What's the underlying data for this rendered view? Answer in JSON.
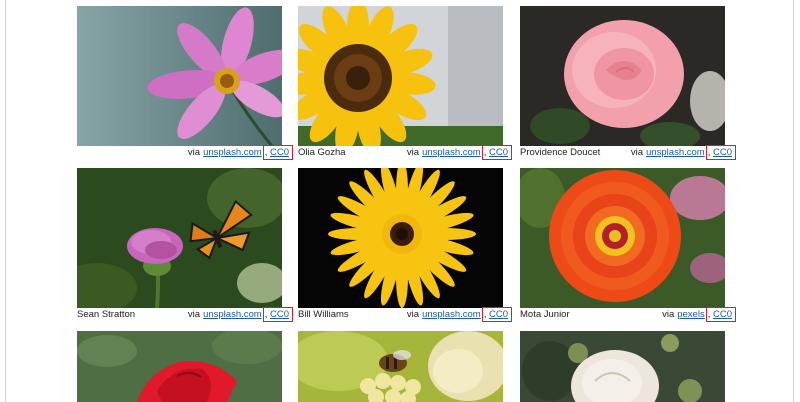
{
  "gallery": {
    "cards": [
      {
        "photographer": "",
        "via": "via",
        "source": "unsplash.com",
        "sep": ",",
        "license": "CC0",
        "subject": "pink cosmos flower",
        "colors": {
          "bg": "#6f9193",
          "petal": "#d779c9",
          "center": "#e0b020"
        }
      },
      {
        "photographer": "Olia Gozha",
        "via": "via",
        "source": "unsplash.com",
        "sep": ",",
        "license": "CC0",
        "subject": "yellow sunflower",
        "colors": {
          "bg": "#c9ccd0",
          "petal": "#f5c510",
          "center": "#4a2a10"
        }
      },
      {
        "photographer": "Providence Doucet",
        "via": "via",
        "source": "unsplash.com",
        "sep": ",",
        "license": "CC0",
        "subject": "pink rose",
        "colors": {
          "bg": "#2b2a28",
          "petal": "#f3a3ad",
          "center": "#e98392"
        }
      },
      {
        "photographer": "Sean Stratton",
        "via": "via",
        "source": "unsplash.com",
        "sep": ",",
        "license": "CC0",
        "subject": "monarch butterfly on thistle",
        "colors": {
          "bg": "#2e4a1c",
          "petal": "#c65fb9",
          "center": "#e88a1a"
        }
      },
      {
        "photographer": "Bill Williams",
        "via": "via",
        "source": "unsplash.com",
        "sep": ",",
        "license": "CC0",
        "subject": "yellow daisy on black",
        "colors": {
          "bg": "#050505",
          "petal": "#f7c411",
          "center": "#3a1d0a"
        }
      },
      {
        "photographer": "Mota Junior",
        "via": "via",
        "source": "pexels",
        "sep": ",",
        "license": "CC0",
        "subject": "orange zinnia",
        "colors": {
          "bg": "#3e5a2a",
          "petal": "#f0501b",
          "center": "#e8c020"
        }
      },
      {
        "photographer": "",
        "via": "",
        "source": "",
        "sep": "",
        "license": "",
        "subject": "red rose",
        "colors": {
          "bg": "#4f6f45",
          "petal": "#e11a2a",
          "center": "#b5101d"
        }
      },
      {
        "photographer": "",
        "via": "",
        "source": "",
        "sep": "",
        "license": "",
        "subject": "bee on yellow flower",
        "colors": {
          "bg": "#a7b83a",
          "petal": "#f1e7a8",
          "center": "#6b4318"
        }
      },
      {
        "photographer": "",
        "via": "",
        "source": "",
        "sep": "",
        "license": "",
        "subject": "white rose",
        "colors": {
          "bg": "#3b4a36",
          "petal": "#eee8e0",
          "center": "#d8cdc0"
        }
      }
    ]
  }
}
